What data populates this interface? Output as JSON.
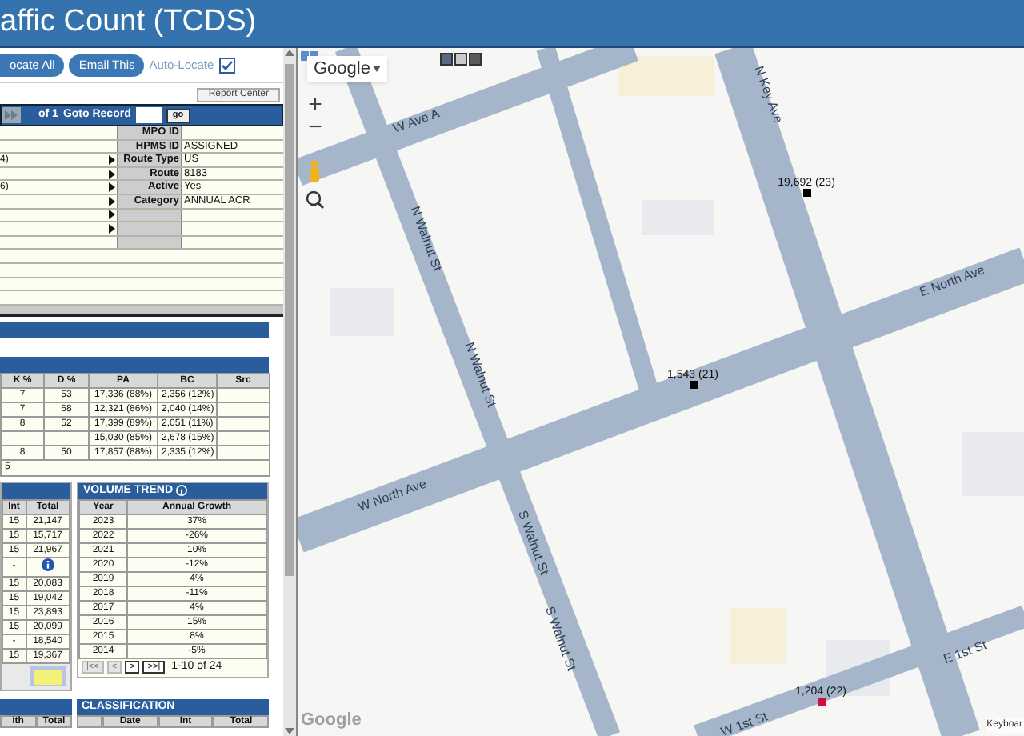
{
  "header": {
    "title": "affic Count (TCDS)"
  },
  "toolbar": {
    "buttons": [
      "ocate All",
      "Email This"
    ],
    "auto_locate": {
      "label": "Auto-Locate",
      "checked": true
    }
  },
  "report_button": "Report Center",
  "record_nav": {
    "of_text": "of 1",
    "goto_label": "Goto Record",
    "go_button": "go"
  },
  "details": [
    {
      "kind": "field",
      "arrow": false,
      "label": "MPO ID"
    },
    {
      "kind": "field",
      "arrow": false,
      "label": "HPMS ID",
      "value": "ASSIGNED"
    },
    {
      "kind": "field",
      "left": "4)",
      "arrow": true,
      "label": "Route Type",
      "value": "US"
    },
    {
      "kind": "field",
      "arrow": true,
      "label": "Route",
      "value": "8183"
    },
    {
      "kind": "field",
      "left": "6)",
      "arrow": true,
      "label": "Active",
      "value": "Yes"
    },
    {
      "kind": "field",
      "arrow": true,
      "label": "Category",
      "value": "ANNUAL ACR"
    },
    {
      "kind": "field",
      "arrow": true
    },
    {
      "kind": "field",
      "arrow": true
    },
    {
      "kind": "field",
      "arrow": false
    },
    {
      "kind": "blank"
    },
    {
      "kind": "blank"
    },
    {
      "kind": "blank"
    },
    {
      "kind": "blank"
    }
  ],
  "counts_table": {
    "columns": [
      "K %",
      "D %",
      "PA",
      "BC",
      "Src"
    ],
    "rows": [
      [
        "7",
        "53",
        "17,336 (88%)",
        "2,356 (12%)",
        null
      ],
      [
        "7",
        "68",
        "12,321 (86%)",
        "2,040 (14%)",
        null
      ],
      [
        "8",
        "52",
        "17,399 (89%)",
        "2,051 (11%)",
        null
      ],
      [
        null,
        null,
        "15,030 (85%)",
        "2,678 (15%)",
        null
      ],
      [
        "8",
        "50",
        "17,857 (88%)",
        "2,335 (12%)",
        null
      ]
    ],
    "footer": "5"
  },
  "history_table": {
    "columns": [
      "Int",
      "Total"
    ],
    "rows": [
      {
        "kind": "value",
        "int": "15",
        "total": "21,147"
      },
      {
        "kind": "value",
        "int": "15",
        "total": "15,717"
      },
      {
        "kind": "value",
        "int": "15",
        "total": "21,967"
      },
      {
        "kind": "info",
        "int": "-"
      },
      {
        "kind": "value",
        "int": "15",
        "total": "20,083"
      },
      {
        "kind": "value",
        "int": "15",
        "total": "19,042"
      },
      {
        "kind": "value",
        "int": "15",
        "total": "23,893"
      },
      {
        "kind": "value",
        "int": "15",
        "total": "20,099"
      },
      {
        "kind": "value",
        "int": "-",
        "total": "18,540"
      },
      {
        "kind": "value",
        "int": "15",
        "total": "19,367"
      }
    ]
  },
  "volume_trend": {
    "title": "VOLUME TREND",
    "columns": [
      "Year",
      "Annual Growth"
    ],
    "rows": [
      [
        "2023",
        "37%"
      ],
      [
        "2022",
        "-26%"
      ],
      [
        "2021",
        "10%"
      ],
      [
        "2020",
        "-12%"
      ],
      [
        "2019",
        "4%"
      ],
      [
        "2018",
        "-11%"
      ],
      [
        "2017",
        "4%"
      ],
      [
        "2016",
        "15%"
      ],
      [
        "2015",
        "8%"
      ],
      [
        "2014",
        "-5%"
      ]
    ],
    "pager": [
      {
        "label": "|<<",
        "disabled": true
      },
      {
        "label": "<",
        "disabled": true
      },
      {
        "label": ">",
        "disabled": false
      },
      {
        "label": ">>|",
        "disabled": false
      }
    ],
    "range": "1-10 of 24"
  },
  "bottom_left": {
    "columns": [
      "ith",
      "Total"
    ]
  },
  "classification": {
    "title": "CLASSIFICATION",
    "columns": [
      null,
      "Date",
      "Int",
      "Total"
    ]
  },
  "map": {
    "provider_menu": "Google",
    "zoom_in": "+",
    "zoom_out": "−",
    "logo": "Google",
    "attribution": "Keyboar",
    "streets": [
      "W Ave A",
      "N Key Ave",
      "N Walnut St",
      "N Walnut St",
      "S Walnut St",
      "S Walnut St",
      "W North Ave",
      "E North Ave",
      "E 1st St",
      "W 1st St"
    ],
    "counts": [
      {
        "label": "19,692 (23)",
        "color": "#000000"
      },
      {
        "label": "1,543 (21)",
        "color": "#000000"
      },
      {
        "label": "1,204 (22)",
        "color": "#d0103a"
      }
    ]
  }
}
